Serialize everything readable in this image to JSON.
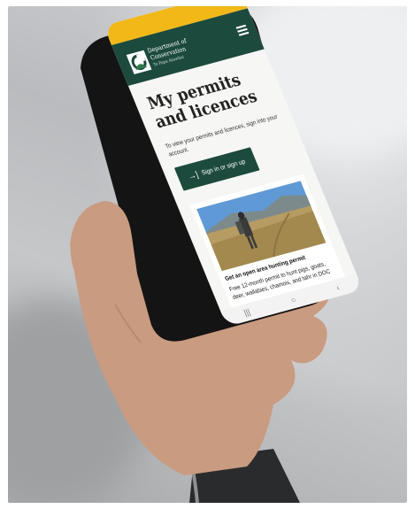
{
  "app": {
    "org_name": "Department of Conservation",
    "org_subtitle": "Te Papa Atawhai"
  },
  "page": {
    "title": "My permits and licences",
    "intro": "To view your permits and licences, sign into your account.",
    "signin_label": "Sign in or sign up",
    "signin_icon": "→]"
  },
  "card": {
    "title": "Get an open area hunting permit",
    "description": "Free 12-month permit to hunt pigs, goats, deer, wallabies, chamois, and tahr in DOC"
  },
  "navbar": {
    "recent": "|||",
    "home": "○",
    "back": "‹"
  },
  "colors": {
    "header_green": "#1c4a3d",
    "accent_yellow": "#f2b817",
    "button_green": "#1c4a3d"
  },
  "icons": [
    "menu-icon",
    "doc-logo-icon",
    "sign-in-icon",
    "recent-apps-icon",
    "home-icon",
    "back-icon"
  ]
}
